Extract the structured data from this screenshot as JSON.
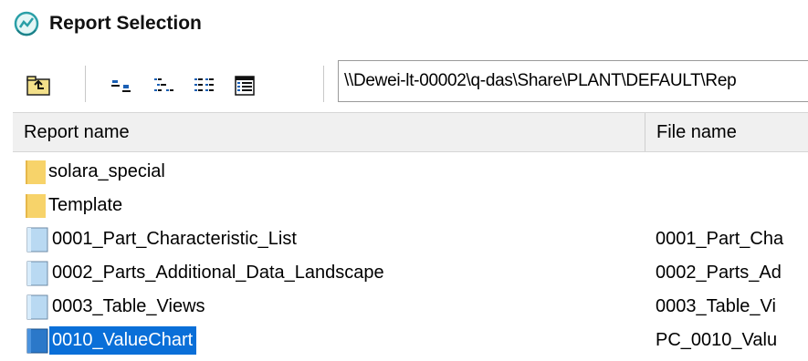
{
  "window": {
    "title": "Report Selection"
  },
  "toolbar": {
    "buttons": [
      {
        "icon": "up-folder-icon"
      },
      {
        "icon": "large-icons-view-icon"
      },
      {
        "icon": "small-icons-view-icon"
      },
      {
        "icon": "list-view-icon"
      },
      {
        "icon": "details-view-icon"
      }
    ],
    "path": "\\\\Dewei-lt-00002\\q-das\\Share\\PLANT\\DEFAULT\\Rep"
  },
  "table": {
    "columns": [
      "Report name",
      "File name"
    ],
    "rows": [
      {
        "type": "folder",
        "name": "solara_special",
        "file": "",
        "selected": false
      },
      {
        "type": "folder",
        "name": "Template",
        "file": "",
        "selected": false
      },
      {
        "type": "report",
        "name": "0001_Part_Characteristic_List",
        "file": "0001_Part_Cha",
        "selected": false
      },
      {
        "type": "report",
        "name": "0002_Parts_Additional_Data_Landscape",
        "file": "0002_Parts_Ad",
        "selected": false
      },
      {
        "type": "report",
        "name": "0003_Table_Views",
        "file": "0003_Table_Vi",
        "selected": false
      },
      {
        "type": "report",
        "name": "0010_ValueChart",
        "file": "PC_0010_Valu",
        "selected": true
      }
    ]
  },
  "colors": {
    "selection": "#0a6fd8",
    "folder": "#f7d36a",
    "header_bg": "#f0f0f0"
  }
}
